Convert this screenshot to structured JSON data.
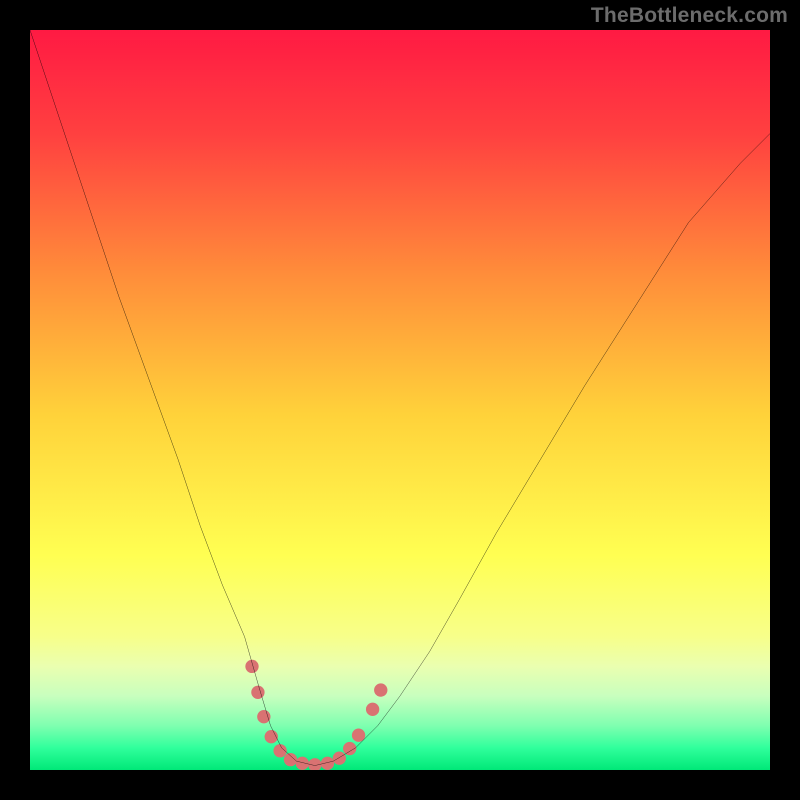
{
  "watermark": "TheBottleneck.com",
  "chart_data": {
    "type": "line",
    "title": "",
    "xlabel": "",
    "ylabel": "",
    "xlim": [
      0,
      100
    ],
    "ylim": [
      0,
      100
    ],
    "grid": false,
    "legend": false,
    "gradient_stops": [
      {
        "pct": 0,
        "color": "#ff1a43"
      },
      {
        "pct": 14,
        "color": "#ff4040"
      },
      {
        "pct": 33,
        "color": "#ff8d3a"
      },
      {
        "pct": 52,
        "color": "#ffd23a"
      },
      {
        "pct": 71,
        "color": "#ffff52"
      },
      {
        "pct": 82,
        "color": "#f7ff8a"
      },
      {
        "pct": 86,
        "color": "#eaffb0"
      },
      {
        "pct": 90,
        "color": "#c8ffbe"
      },
      {
        "pct": 94,
        "color": "#7fffb0"
      },
      {
        "pct": 97,
        "color": "#30ff9c"
      },
      {
        "pct": 100,
        "color": "#00e878"
      }
    ],
    "series": [
      {
        "name": "curve",
        "stroke": "#000000",
        "x": [
          0,
          4,
          8,
          12,
          16,
          20,
          23,
          26,
          29,
          31,
          32.5,
          34,
          36,
          38.5,
          41,
          44,
          47,
          50,
          54,
          58,
          63,
          69,
          75,
          82,
          89,
          96,
          100
        ],
        "y": [
          100,
          88,
          76,
          64,
          53,
          42,
          33,
          25,
          18,
          11,
          6,
          3,
          1.2,
          0.6,
          1.2,
          3,
          6,
          10,
          16,
          23,
          32,
          42,
          52,
          63,
          74,
          82,
          86
        ]
      }
    ],
    "markers": {
      "color": "#d97272",
      "radius_pct": 0.9,
      "points": [
        {
          "x": 30.0,
          "y": 14.0
        },
        {
          "x": 30.8,
          "y": 10.5
        },
        {
          "x": 31.6,
          "y": 7.2
        },
        {
          "x": 32.6,
          "y": 4.5
        },
        {
          "x": 33.8,
          "y": 2.6
        },
        {
          "x": 35.2,
          "y": 1.4
        },
        {
          "x": 36.8,
          "y": 0.9
        },
        {
          "x": 38.5,
          "y": 0.7
        },
        {
          "x": 40.2,
          "y": 0.9
        },
        {
          "x": 41.8,
          "y": 1.6
        },
        {
          "x": 43.2,
          "y": 2.9
        },
        {
          "x": 44.4,
          "y": 4.7
        },
        {
          "x": 46.3,
          "y": 8.2
        },
        {
          "x": 47.4,
          "y": 10.8
        }
      ]
    }
  }
}
